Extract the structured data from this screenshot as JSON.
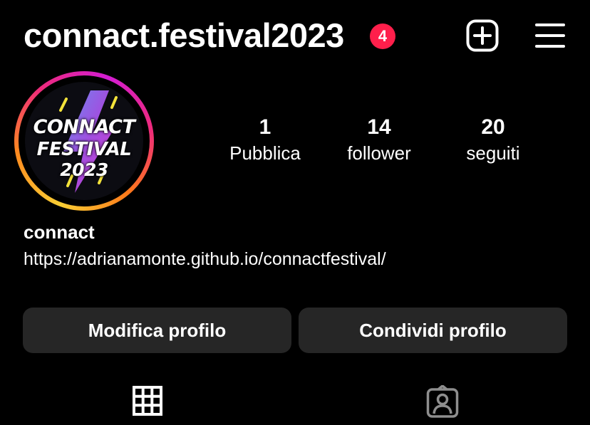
{
  "header": {
    "username": "connact.festival2023",
    "notification_count": "4",
    "icons": {
      "new_post": "plus-square-icon",
      "menu": "hamburger-menu-icon"
    }
  },
  "profile": {
    "avatar": {
      "logo_lines": [
        "CONNACT",
        "FESTIVAL",
        "2023"
      ],
      "ring_colors": [
        "#f9ce34",
        "#ee2a7b",
        "#d31dd3"
      ]
    },
    "stats": [
      {
        "value": "1",
        "label": "Pubblica"
      },
      {
        "value": "14",
        "label": "follower"
      },
      {
        "value": "20",
        "label": "seguiti"
      }
    ],
    "display_name": "connact",
    "website": "https://adrianamonte.github.io/connactfestival/"
  },
  "actions": {
    "edit_label": "Modifica profilo",
    "share_label": "Condividi profilo"
  },
  "tabs": [
    {
      "icon": "grid-icon",
      "active": true
    },
    {
      "icon": "tagged-person-icon",
      "active": false
    }
  ],
  "colors": {
    "background": "#000000",
    "button_bg": "#262626",
    "badge": "#ff1f4b"
  }
}
